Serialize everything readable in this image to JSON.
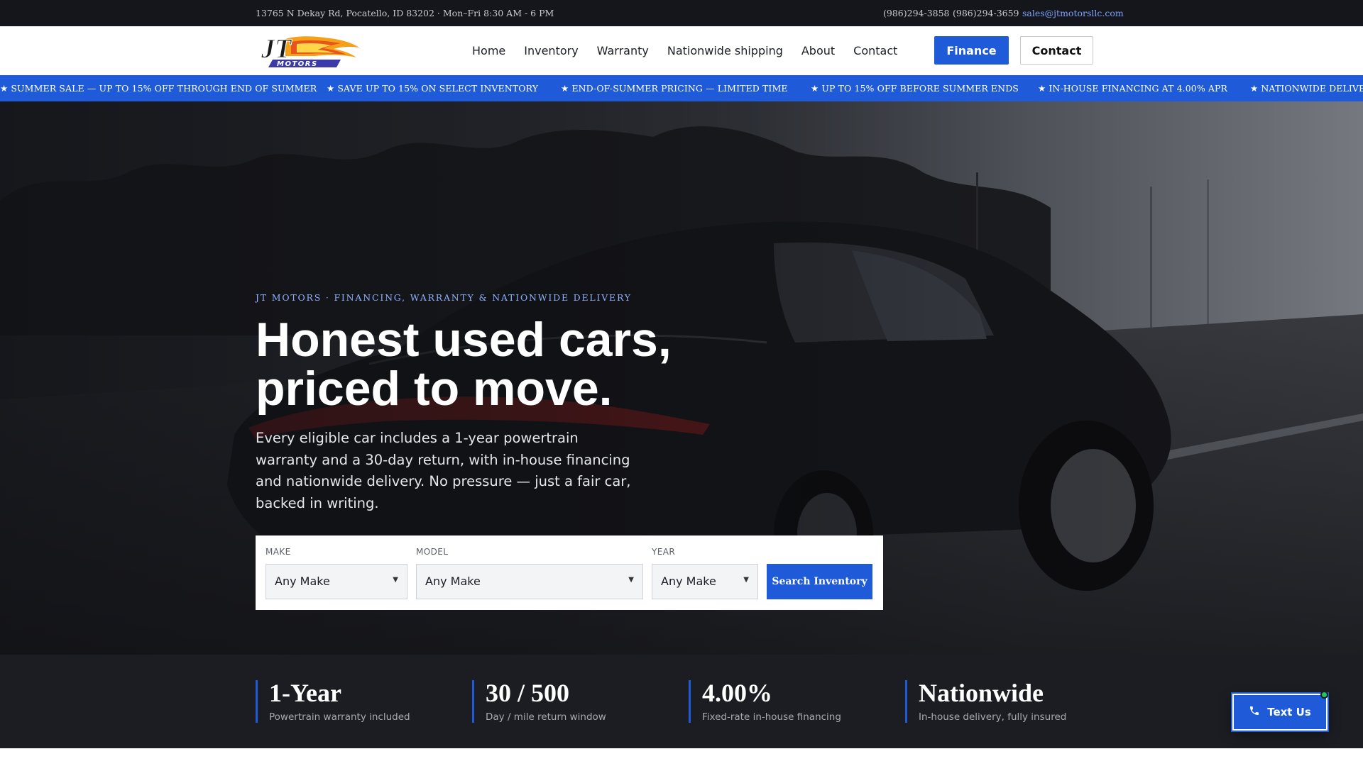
{
  "topbar": {
    "address": "13765 N Dekay Rd, Pocatello, ID 83202 ·  Mon–Fri 8:30 AM - 6 PM",
    "phone_1": "(986)294-3858",
    "phone_2": "(986)294-3659",
    "email": "sales@jtmotorsllc.com"
  },
  "nav": {
    "logo_text": "JT MOTORS",
    "links": [
      "Home",
      "Inventory",
      "Warranty",
      "Nationwide shipping",
      "About",
      "Contact"
    ],
    "finance_button": "Finance",
    "contact_button": "Contact"
  },
  "ticker": {
    "items": [
      "★ SUMMER SALE — UP TO 15% OFF THROUGH END OF SUMMER",
      "★ SAVE UP TO 15% ON SELECT INVENTORY",
      "★ END-OF-SUMMER PRICING — LIMITED TIME",
      "★ UP TO 15% OFF BEFORE SUMMER ENDS",
      "★ IN-HOUSE FINANCING AT 4.00% APR",
      "★ NATIONWIDE DELIVERY"
    ]
  },
  "hero": {
    "eyebrow": "JT MOTORS · FINANCING, WARRANTY & NATIONWIDE DELIVERY",
    "headline_line1": "Honest used cars,",
    "headline_line2": "priced to move.",
    "subcopy": "Every eligible car includes a 1-year powertrain warranty and a 30-day return, with in-house financing and nationwide delivery. No pressure — just a fair car, backed in writing."
  },
  "search": {
    "make_label": "MAKE",
    "make_value": "Any Make",
    "model_label": "MODEL",
    "model_value": "Any Make",
    "year_label": "YEAR",
    "year_value": "Any Make",
    "button": "Search Inventory"
  },
  "stats": [
    {
      "value": "1-Year",
      "caption": "Powertrain warranty included"
    },
    {
      "value": "30 / 500",
      "caption": "Day / mile return window"
    },
    {
      "value": "4.00%",
      "caption": "Fixed-rate in-house financing"
    },
    {
      "value": "Nationwide",
      "caption": "In-house delivery, fully insured"
    }
  ],
  "floating": {
    "text_us": "Text Us"
  },
  "colors": {
    "accent": "#1f5bd8",
    "dark": "#14161c",
    "stats_bg": "#1c1d22",
    "online_dot": "#22c55e"
  }
}
